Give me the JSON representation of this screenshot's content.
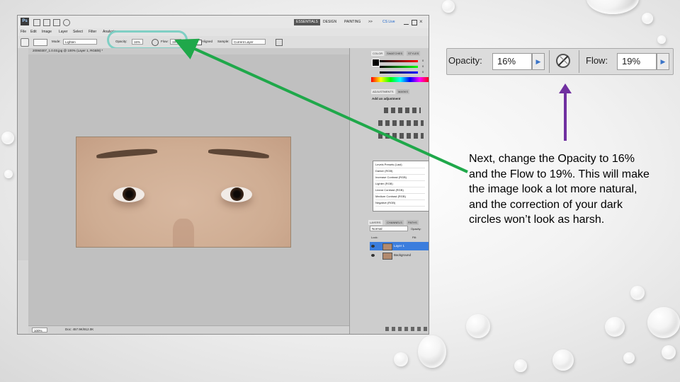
{
  "photoshop": {
    "app_logo": "Ps",
    "workspaces": {
      "essentials": "ESSENTIALS",
      "design": "DESIGN",
      "painting": "PAINTING",
      "more": ">>",
      "cs_live": "CS Live"
    },
    "menu": [
      "File",
      "Edit",
      "Image",
      "Layer",
      "Select",
      "Filter",
      "Analysis"
    ],
    "options": {
      "mode_label": "Mode:",
      "mode_value": "Lighten",
      "opacity_label": "Opacity:",
      "opacity_value": "16%",
      "flow_label": "Flow:",
      "flow_value": "19%",
      "aligned_sample": "Aligned",
      "sample_label": "Sample:",
      "sample_value": "Current Layer"
    },
    "document_tab": "20060307_1.0.03.jpg @ 100% (Layer 1, RGB/8) *",
    "status": {
      "zoom": "100%",
      "doc_size": "Doc: 457.9K/912.0K"
    },
    "panels": {
      "color_tabs": [
        "COLOR",
        "SWATCHES",
        "STYLES"
      ],
      "color_values": [
        "0",
        "0",
        "0"
      ],
      "adjustment_tabs": [
        "ADJUSTMENTS",
        "MASKS"
      ],
      "add_adjustment": "Add an adjustment",
      "presets": [
        "Levels Presets (Last)",
        "Darker (RGB)",
        "Increase Contrast (RGB)",
        "Lighter (RGB)",
        "Linear Contrast (RGB)",
        "Medium Contrast (RGB)",
        "Negative (RGB)"
      ],
      "layers_tabs": [
        "LAYERS",
        "CHANNELS",
        "PATHS"
      ],
      "blend_mode": "Normal",
      "opacity_label": "Opacity:",
      "opacity_value": "100%",
      "lock_label": "Lock:",
      "fill_label": "Fill:",
      "fill_value": "100%",
      "layers": [
        "Layer 1",
        "Background"
      ]
    }
  },
  "zoom_options": {
    "opacity_label": "Opacity:",
    "opacity_value": "16%",
    "flow_label": "Flow:",
    "flow_value": "19%"
  },
  "caption": "Next, change the Opacity to 16% and the Flow to 19%.  This will make the image look a lot more natural, and the correction of your dark circles won’t look as harsh.",
  "colors": {
    "arrow_green": "#1fa84a",
    "arrow_purple": "#7030a0",
    "highlight_teal": "#7fcfc4",
    "selected_layer": "#3b7ddd"
  }
}
